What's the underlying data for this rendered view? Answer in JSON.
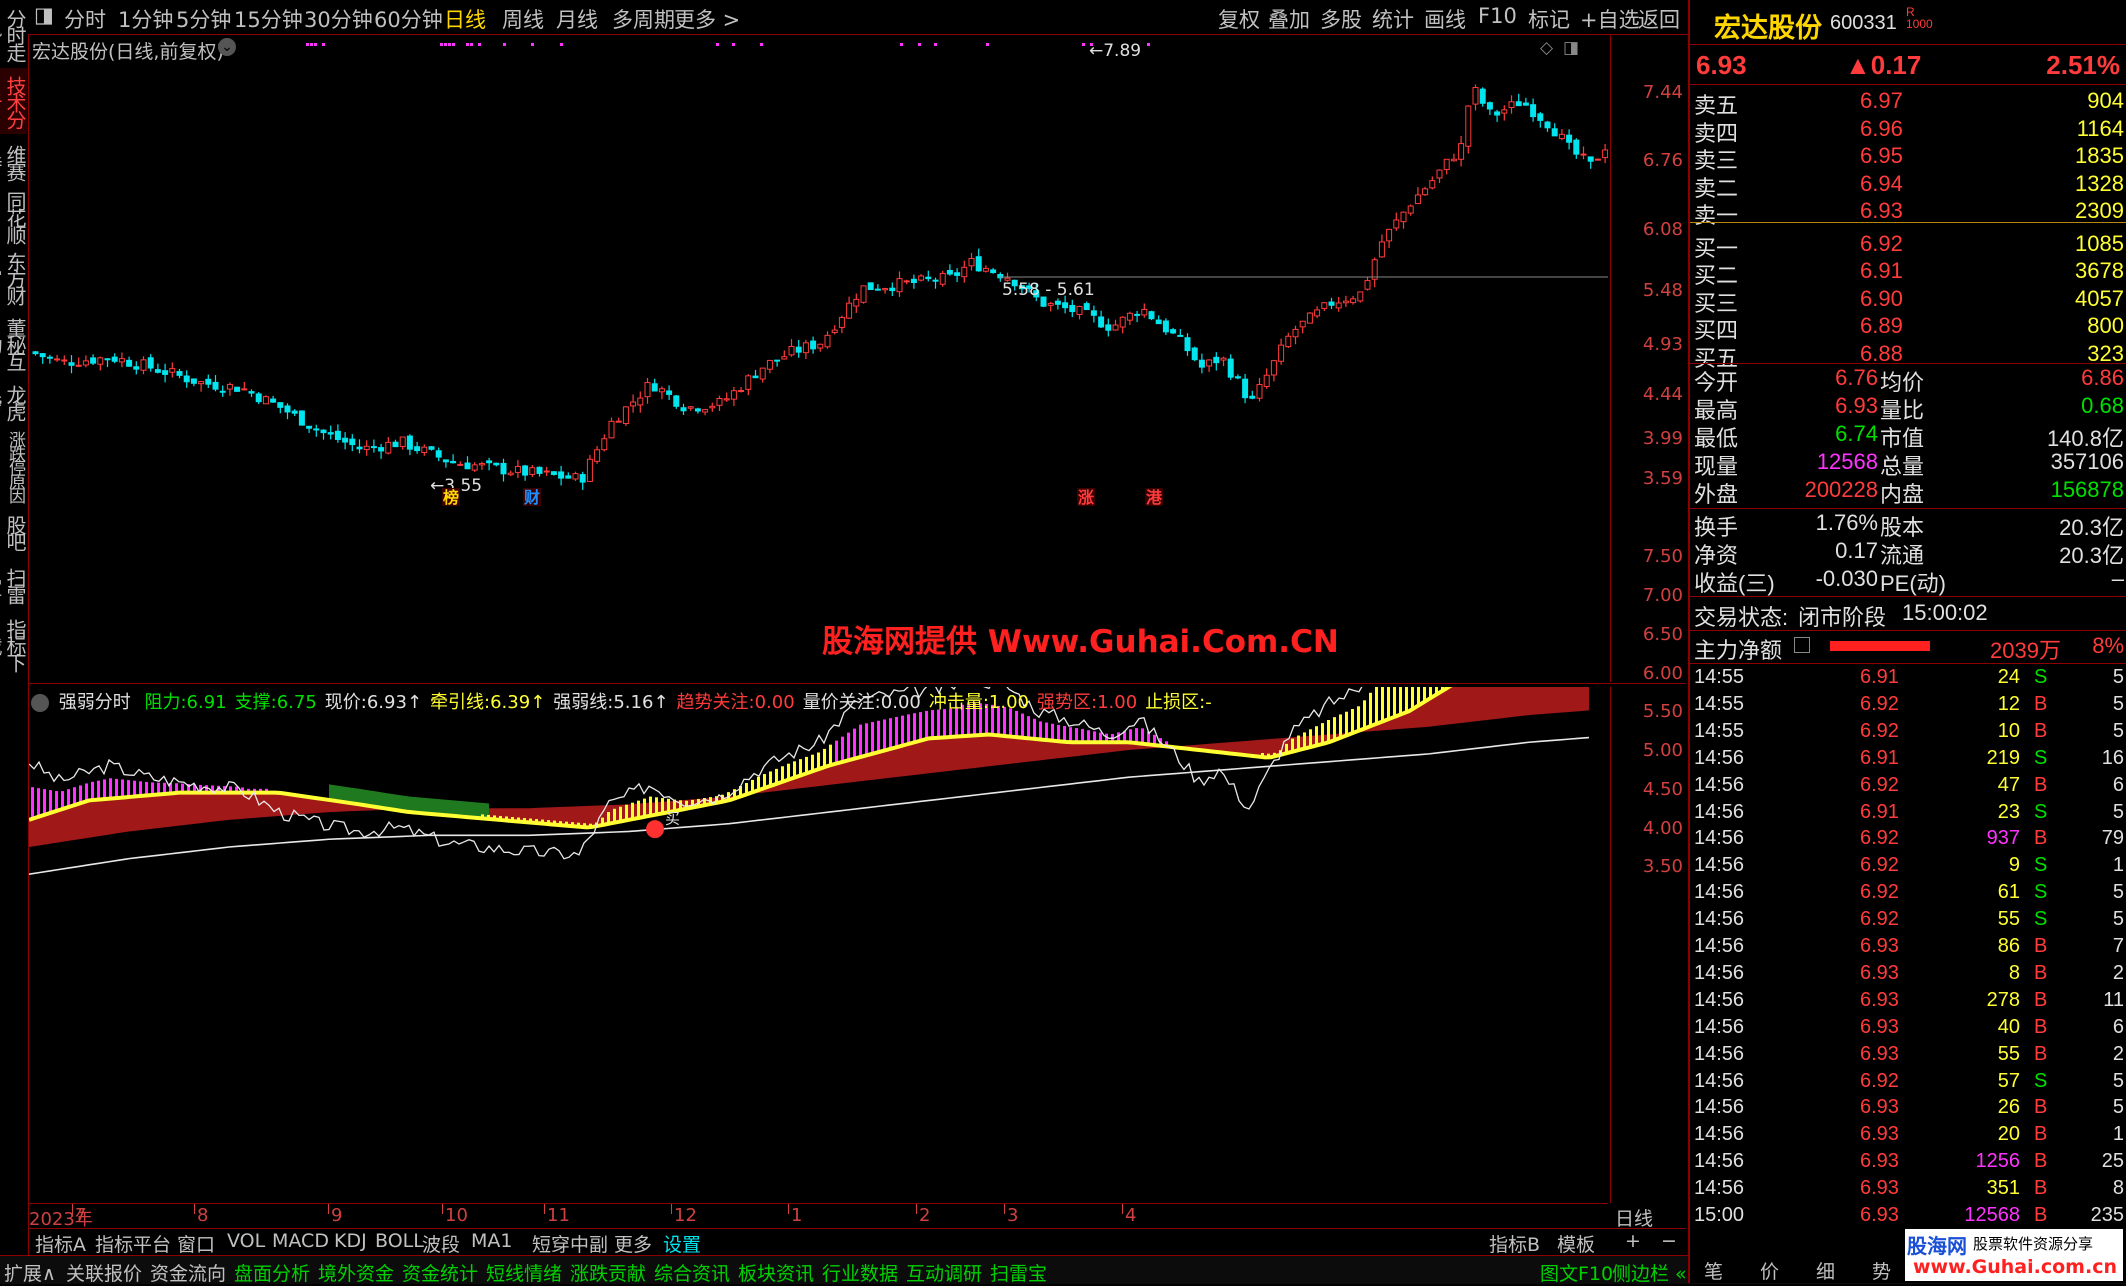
{
  "left_tabs": [
    "分时走势",
    "技术分析",
    "维赛特",
    "同花顺",
    "东方财富",
    "董秘互动",
    "龙虎榜",
    "涨跌停原因",
    "股吧",
    "扫雷宝",
    "指标下载"
  ],
  "top_toolbar": {
    "periods": [
      "分时",
      "1分钟",
      "5分钟",
      "15分钟",
      "30分钟",
      "60分钟",
      "日线",
      "周线",
      "月线",
      "多周期",
      "更多 >"
    ],
    "selected": "日线",
    "actions": [
      "复权",
      "叠加",
      "多股",
      "统计",
      "画线",
      "F10",
      "标记",
      "+自选",
      "返回"
    ]
  },
  "main_chart": {
    "title": "宏达股份(日线,前复权)",
    "yticks": [
      "7.44",
      "6.76",
      "6.08",
      "5.48",
      "4.93",
      "4.44",
      "3.99",
      "3.59"
    ],
    "annotations": {
      "high": "7.89",
      "low": "3.55",
      "range": "5.58 - 5.61"
    },
    "event_markers": [
      "榜",
      "财",
      "涨",
      "港"
    ],
    "watermark": "股海网提供 Www.Guhai.Com.CN"
  },
  "indicator": {
    "name": "强弱分时",
    "params": [
      {
        "label": "阻力:",
        "value": "6.91",
        "color": "#00e000"
      },
      {
        "label": "支撑:",
        "value": "6.75",
        "color": "#00e000"
      },
      {
        "label": "现价:",
        "value": "6.93↑",
        "color": "#e0e0e0"
      },
      {
        "label": "牵引线:",
        "value": "6.39↑",
        "color": "#ffff33"
      },
      {
        "label": "强弱线:",
        "value": "5.16↑",
        "color": "#e0e0e0"
      },
      {
        "label": "趋势关注:",
        "value": "0.00",
        "color": "#ff3b3b"
      },
      {
        "label": "量价关注:",
        "value": "0.00",
        "color": "#e0e0e0"
      },
      {
        "label": "冲击量:",
        "value": "1.00",
        "color": "#ffff33"
      },
      {
        "label": "强势区:",
        "value": "1.00",
        "color": "#ff3b3b"
      },
      {
        "label": "止损区:",
        "value": "-",
        "color": "#ffff33"
      }
    ],
    "yticks": [
      "7.50",
      "7.00",
      "6.50",
      "6.00",
      "5.50",
      "5.00",
      "4.50",
      "4.00",
      "3.50"
    ],
    "signals": {
      "sell": "卖",
      "buy": "买"
    }
  },
  "time_axis": {
    "labels": [
      "2023年",
      "7",
      "8",
      "9",
      "10",
      "11",
      "12",
      "1",
      "2",
      "3",
      "4"
    ],
    "period_label": "日线"
  },
  "bottom_tabs": [
    "指标A",
    "指标平台",
    "窗口",
    "VOL",
    "MACD",
    "KDJ",
    "BOLL",
    "波段",
    "MA1",
    "短穿中副",
    "更多",
    "设置"
  ],
  "bottom_right_tabs": [
    "指标B",
    "模板",
    "+",
    "−"
  ],
  "bottom_bar2": [
    "扩展∧",
    "关联报价",
    "资金流向",
    "盘面分析",
    "境外资金",
    "资金统计",
    "短线情绪",
    "涨跌贡献",
    "综合资讯",
    "板块资讯",
    "行业数据",
    "互动调研",
    "扫雷宝"
  ],
  "bottom_bar2_right": [
    "图文F10",
    "侧边栏 «"
  ],
  "stock": {
    "name": "宏达股份",
    "code": "600331",
    "price": "6.93",
    "change": "▲0.17",
    "pct": "2.51%",
    "asks": [
      {
        "label": "卖五",
        "price": "6.97",
        "vol": "904"
      },
      {
        "label": "卖四",
        "price": "6.96",
        "vol": "1164"
      },
      {
        "label": "卖三",
        "price": "6.95",
        "vol": "1835"
      },
      {
        "label": "卖二",
        "price": "6.94",
        "vol": "1328"
      },
      {
        "label": "卖一",
        "price": "6.93",
        "vol": "2309"
      }
    ],
    "bids": [
      {
        "label": "买一",
        "price": "6.92",
        "vol": "1085"
      },
      {
        "label": "买二",
        "price": "6.91",
        "vol": "3678"
      },
      {
        "label": "买三",
        "price": "6.90",
        "vol": "4057"
      },
      {
        "label": "买四",
        "price": "6.89",
        "vol": "800"
      },
      {
        "label": "买五",
        "price": "6.88",
        "vol": "323"
      }
    ],
    "stats": [
      {
        "l1": "今开",
        "v1": "6.76",
        "c1": "red",
        "l2": "均价",
        "v2": "6.86",
        "c2": "red"
      },
      {
        "l1": "最高",
        "v1": "6.93",
        "c1": "red",
        "l2": "量比",
        "v2": "0.68",
        "c2": "green"
      },
      {
        "l1": "最低",
        "v1": "6.74",
        "c1": "green",
        "l2": "市值",
        "v2": "140.8亿",
        "c2": "white"
      },
      {
        "l1": "现量",
        "v1": "12568",
        "c1": "magenta",
        "l2": "总量",
        "v2": "357106",
        "c2": "white"
      },
      {
        "l1": "外盘",
        "v1": "200228",
        "c1": "red",
        "l2": "内盘",
        "v2": "156878",
        "c2": "green"
      }
    ],
    "stats2": [
      {
        "l1": "换手",
        "v1": "1.76%",
        "c1": "white",
        "l2": "股本",
        "v2": "20.3亿",
        "c2": "white"
      },
      {
        "l1": "净资",
        "v1": "0.17",
        "c1": "white",
        "l2": "流通",
        "v2": "20.3亿",
        "c2": "white"
      },
      {
        "l1": "收益(三)",
        "v1": "-0.030",
        "c1": "white",
        "l2": "PE(动)",
        "v2": "–",
        "c2": "white"
      }
    ],
    "trade_status_label": "交易状态:",
    "trade_status": "闭市阶段",
    "trade_time": "15:00:02",
    "main_flow_label": "主力净额",
    "main_flow": "2039万",
    "main_flow_pct": "8%",
    "ticks": [
      {
        "t": "14:55",
        "p": "6.91",
        "pc": "red",
        "v": "24",
        "vc": "yellow",
        "d": "S",
        "n": "5"
      },
      {
        "t": "14:55",
        "p": "6.92",
        "pc": "red",
        "v": "12",
        "vc": "yellow",
        "d": "B",
        "n": "5"
      },
      {
        "t": "14:55",
        "p": "6.92",
        "pc": "red",
        "v": "10",
        "vc": "yellow",
        "d": "B",
        "n": "5"
      },
      {
        "t": "14:56",
        "p": "6.91",
        "pc": "red",
        "v": "219",
        "vc": "yellow",
        "d": "S",
        "n": "16"
      },
      {
        "t": "14:56",
        "p": "6.92",
        "pc": "red",
        "v": "47",
        "vc": "yellow",
        "d": "B",
        "n": "6"
      },
      {
        "t": "14:56",
        "p": "6.91",
        "pc": "red",
        "v": "23",
        "vc": "yellow",
        "d": "S",
        "n": "5"
      },
      {
        "t": "14:56",
        "p": "6.92",
        "pc": "red",
        "v": "937",
        "vc": "magenta",
        "d": "B",
        "n": "79"
      },
      {
        "t": "14:56",
        "p": "6.92",
        "pc": "red",
        "v": "9",
        "vc": "yellow",
        "d": "S",
        "n": "1"
      },
      {
        "t": "14:56",
        "p": "6.92",
        "pc": "red",
        "v": "61",
        "vc": "yellow",
        "d": "S",
        "n": "5"
      },
      {
        "t": "14:56",
        "p": "6.92",
        "pc": "red",
        "v": "55",
        "vc": "yellow",
        "d": "S",
        "n": "5"
      },
      {
        "t": "14:56",
        "p": "6.93",
        "pc": "red",
        "v": "86",
        "vc": "yellow",
        "d": "B",
        "n": "7"
      },
      {
        "t": "14:56",
        "p": "6.93",
        "pc": "red",
        "v": "8",
        "vc": "yellow",
        "d": "B",
        "n": "2"
      },
      {
        "t": "14:56",
        "p": "6.93",
        "pc": "red",
        "v": "278",
        "vc": "yellow",
        "d": "B",
        "n": "11"
      },
      {
        "t": "14:56",
        "p": "6.93",
        "pc": "red",
        "v": "40",
        "vc": "yellow",
        "d": "B",
        "n": "6"
      },
      {
        "t": "14:56",
        "p": "6.93",
        "pc": "red",
        "v": "55",
        "vc": "yellow",
        "d": "B",
        "n": "2"
      },
      {
        "t": "14:56",
        "p": "6.92",
        "pc": "red",
        "v": "57",
        "vc": "yellow",
        "d": "S",
        "n": "5"
      },
      {
        "t": "14:56",
        "p": "6.93",
        "pc": "red",
        "v": "26",
        "vc": "yellow",
        "d": "B",
        "n": "5"
      },
      {
        "t": "14:56",
        "p": "6.93",
        "pc": "red",
        "v": "20",
        "vc": "yellow",
        "d": "B",
        "n": "1"
      },
      {
        "t": "14:56",
        "p": "6.93",
        "pc": "red",
        "v": "1256",
        "vc": "magenta",
        "d": "B",
        "n": "25"
      },
      {
        "t": "14:56",
        "p": "6.93",
        "pc": "red",
        "v": "351",
        "vc": "yellow",
        "d": "B",
        "n": "8"
      },
      {
        "t": "15:00",
        "p": "6.93",
        "pc": "red",
        "v": "12568",
        "vc": "magenta",
        "d": "B",
        "n": "235"
      }
    ],
    "bottom_tabs": [
      "笔",
      "价",
      "细",
      "势"
    ],
    "logo_text": "股海网",
    "logo_sub": "股票软件资源分享",
    "logo_url": "www.Guhai.com.cn"
  },
  "colors": {
    "up": "#ff3b3b",
    "down": "#00e5ee",
    "grid": "#8b0000",
    "accent": "#ffd700"
  }
}
